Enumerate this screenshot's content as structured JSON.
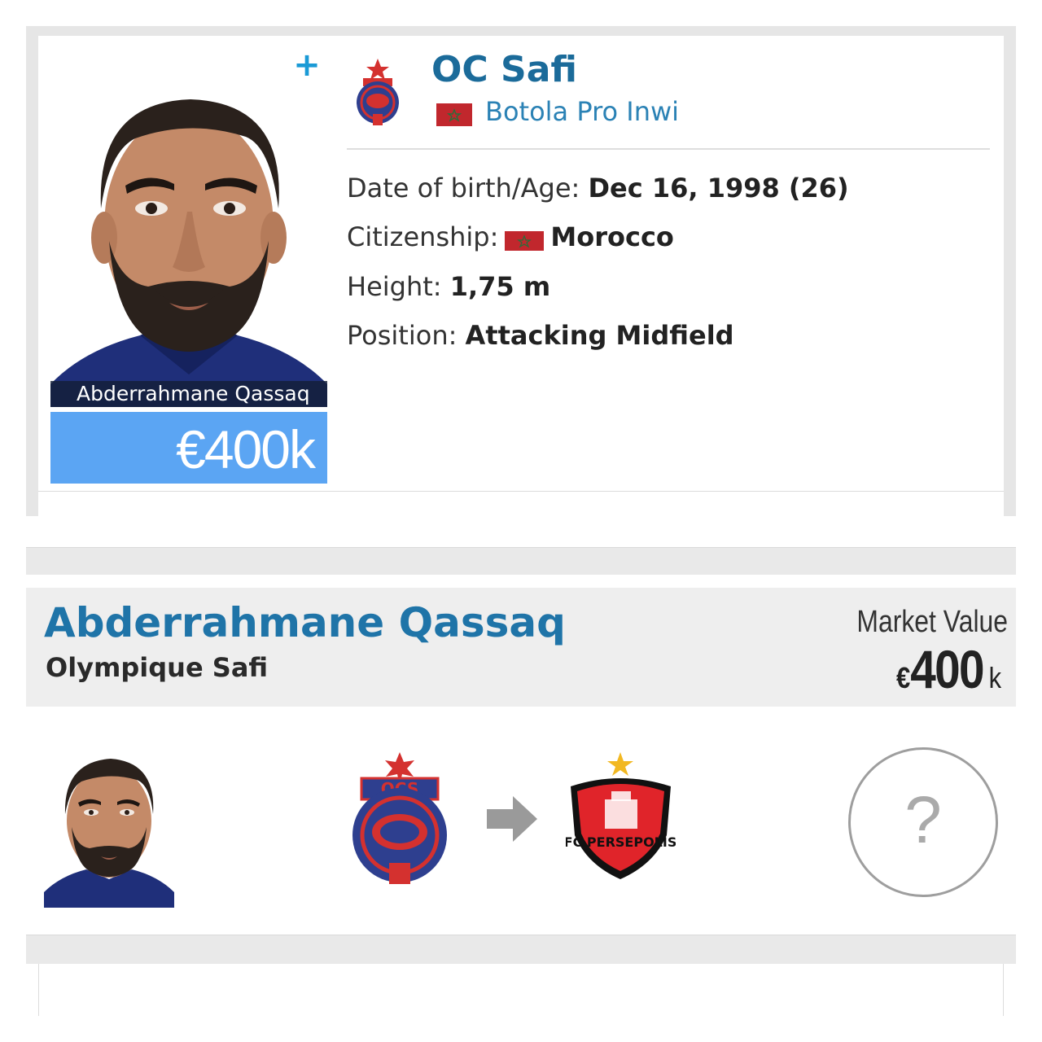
{
  "profile_card": {
    "player_name_overlay": "Abderrahmane Qassaq",
    "market_value": "€400k",
    "add_icon": "plus-icon",
    "club": {
      "name": "OC Safi",
      "league": "Botola Pro Inwi",
      "league_flag": "morocco-flag-icon"
    },
    "info": {
      "dob_label": "Date of birth/Age:",
      "dob_value": "Dec 16, 1998 (26)",
      "citizenship_label": "Citizenship:",
      "citizenship_value": "Morocco",
      "height_label": "Height:",
      "height_value": "1,75 m",
      "position_label": "Position:",
      "position_value": "Attacking Midfield"
    }
  },
  "transfer_card": {
    "player_name": "Abderrahmane Qassaq",
    "club": "Olympique Safi",
    "market_value_label": "Market Value",
    "market_value_currency": "€",
    "market_value_number": "400",
    "market_value_unit": "k",
    "from_club_crest": "oc-safi-crest",
    "to_club_crest": "persepolis-crest",
    "unknown_fee": "?"
  },
  "colors": {
    "accent_blue": "#1f74a8",
    "link_blue": "#2b82b5",
    "value_box": "#5ba5f3",
    "morocco_red": "#c1272d",
    "persepolis_red": "#e0242a"
  }
}
